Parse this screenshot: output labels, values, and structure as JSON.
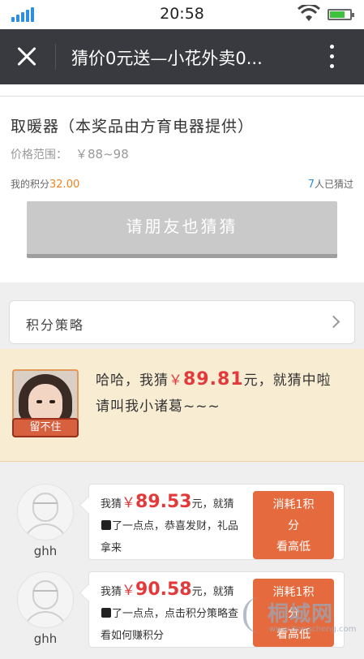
{
  "status_bar": {
    "time": "20:58"
  },
  "nav": {
    "title": "猜价0元送—小花外卖0..."
  },
  "product": {
    "name": "取暖器（本奖品由方育电器提供）",
    "price_label": "价格范围：",
    "price_value": "￥88~98",
    "points_label": "我的积分",
    "points_value": "32.00",
    "guessed_count": "7",
    "guessed_label": "人已猜过",
    "invite_button": "请朋友也猜猜"
  },
  "strategy": {
    "label": "积分策略"
  },
  "highlight": {
    "badge": "留不住",
    "prefix": "哈哈，我猜",
    "yen": "￥",
    "amount": "89.81",
    "suffix": "元，就猜中啦",
    "line2": "请叫我小诸葛~~~"
  },
  "guesses": [
    {
      "name": "ghh",
      "prefix": "我猜",
      "yen": "￥",
      "amount": "89.53",
      "mid": "元，就猜",
      "rest": "了一点点，恭喜发财，礼品拿来",
      "btn_line1": "消耗1积",
      "btn_line2": "分",
      "btn_line3": "看高低"
    },
    {
      "name": "ghh",
      "prefix": "我猜",
      "yen": "￥",
      "amount": "90.58",
      "mid": "元，就猜",
      "rest": "了一点点，点击积分策略查看如何赚积分",
      "btn_line1": "消耗1积",
      "btn_line2": "分",
      "btn_line3": "看高低"
    }
  ],
  "watermark": {
    "main": "桐城网",
    "sub": "www.itongcheng.com"
  },
  "colors": {
    "accent_red": "#e23a3a",
    "button_orange": "#e56b3f",
    "points_orange": "#f0821e",
    "nav_bg": "#393a3f"
  }
}
